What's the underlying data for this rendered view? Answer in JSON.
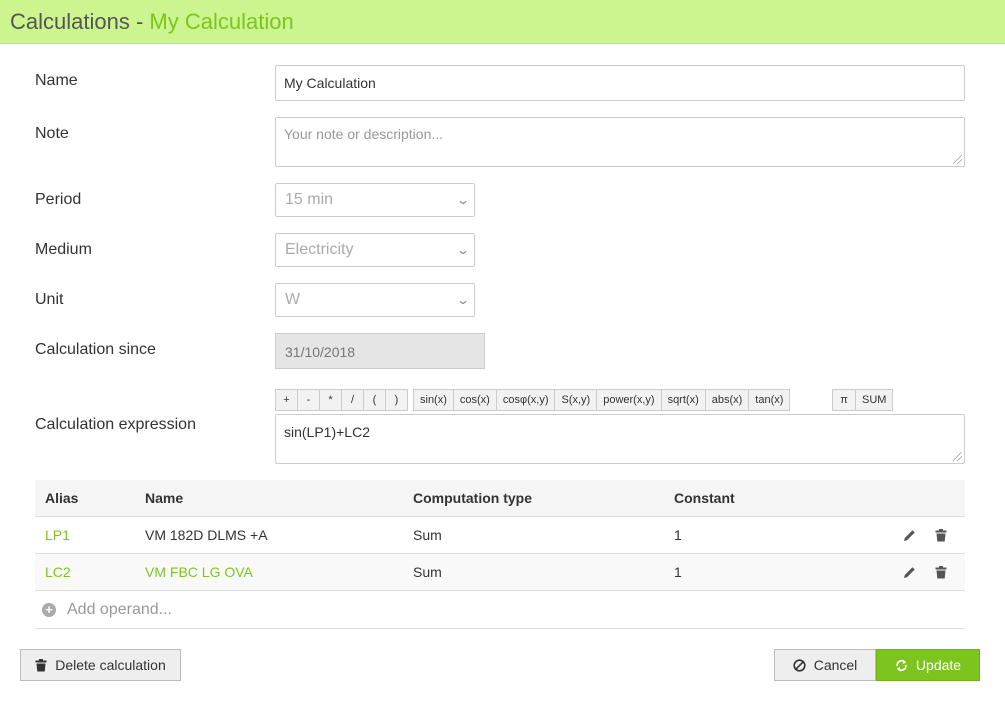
{
  "header": {
    "title": "Calculations",
    "separator": "-",
    "subtitle": "My Calculation"
  },
  "form": {
    "name": {
      "label": "Name",
      "value": "My Calculation"
    },
    "note": {
      "label": "Note",
      "placeholder": "Your note or description..."
    },
    "period": {
      "label": "Period",
      "value": "15 min"
    },
    "medium": {
      "label": "Medium",
      "value": "Electricity"
    },
    "unit": {
      "label": "Unit",
      "value": "W"
    },
    "since": {
      "label": "Calculation since",
      "value": "31/10/2018"
    },
    "expression": {
      "label": "Calculation expression",
      "value": "sin(LP1)+LC2"
    }
  },
  "operators": {
    "arith": [
      "+",
      "-",
      "*",
      "/",
      "(",
      ")"
    ],
    "functions": [
      "sin(x)",
      "cos(x)",
      "cosφ(x,y)",
      "S(x,y)",
      "power(x,y)",
      "sqrt(x)",
      "abs(x)",
      "tan(x)"
    ],
    "constants": [
      "π",
      "SUM"
    ]
  },
  "table": {
    "headers": {
      "alias": "Alias",
      "name": "Name",
      "type": "Computation type",
      "constant": "Constant"
    },
    "rows": [
      {
        "alias": "LP1",
        "name": "VM 182D DLMS +A",
        "type": "Sum",
        "constant": "1"
      },
      {
        "alias": "LC2",
        "name": "VM FBC LG OVA",
        "type": "Sum",
        "constant": "1"
      }
    ],
    "add_label": "Add operand..."
  },
  "actions": {
    "delete": "Delete calculation",
    "cancel": "Cancel",
    "update": "Update"
  },
  "colors": {
    "accent": "#7cc51e",
    "header_bg": "#cdf58f"
  }
}
